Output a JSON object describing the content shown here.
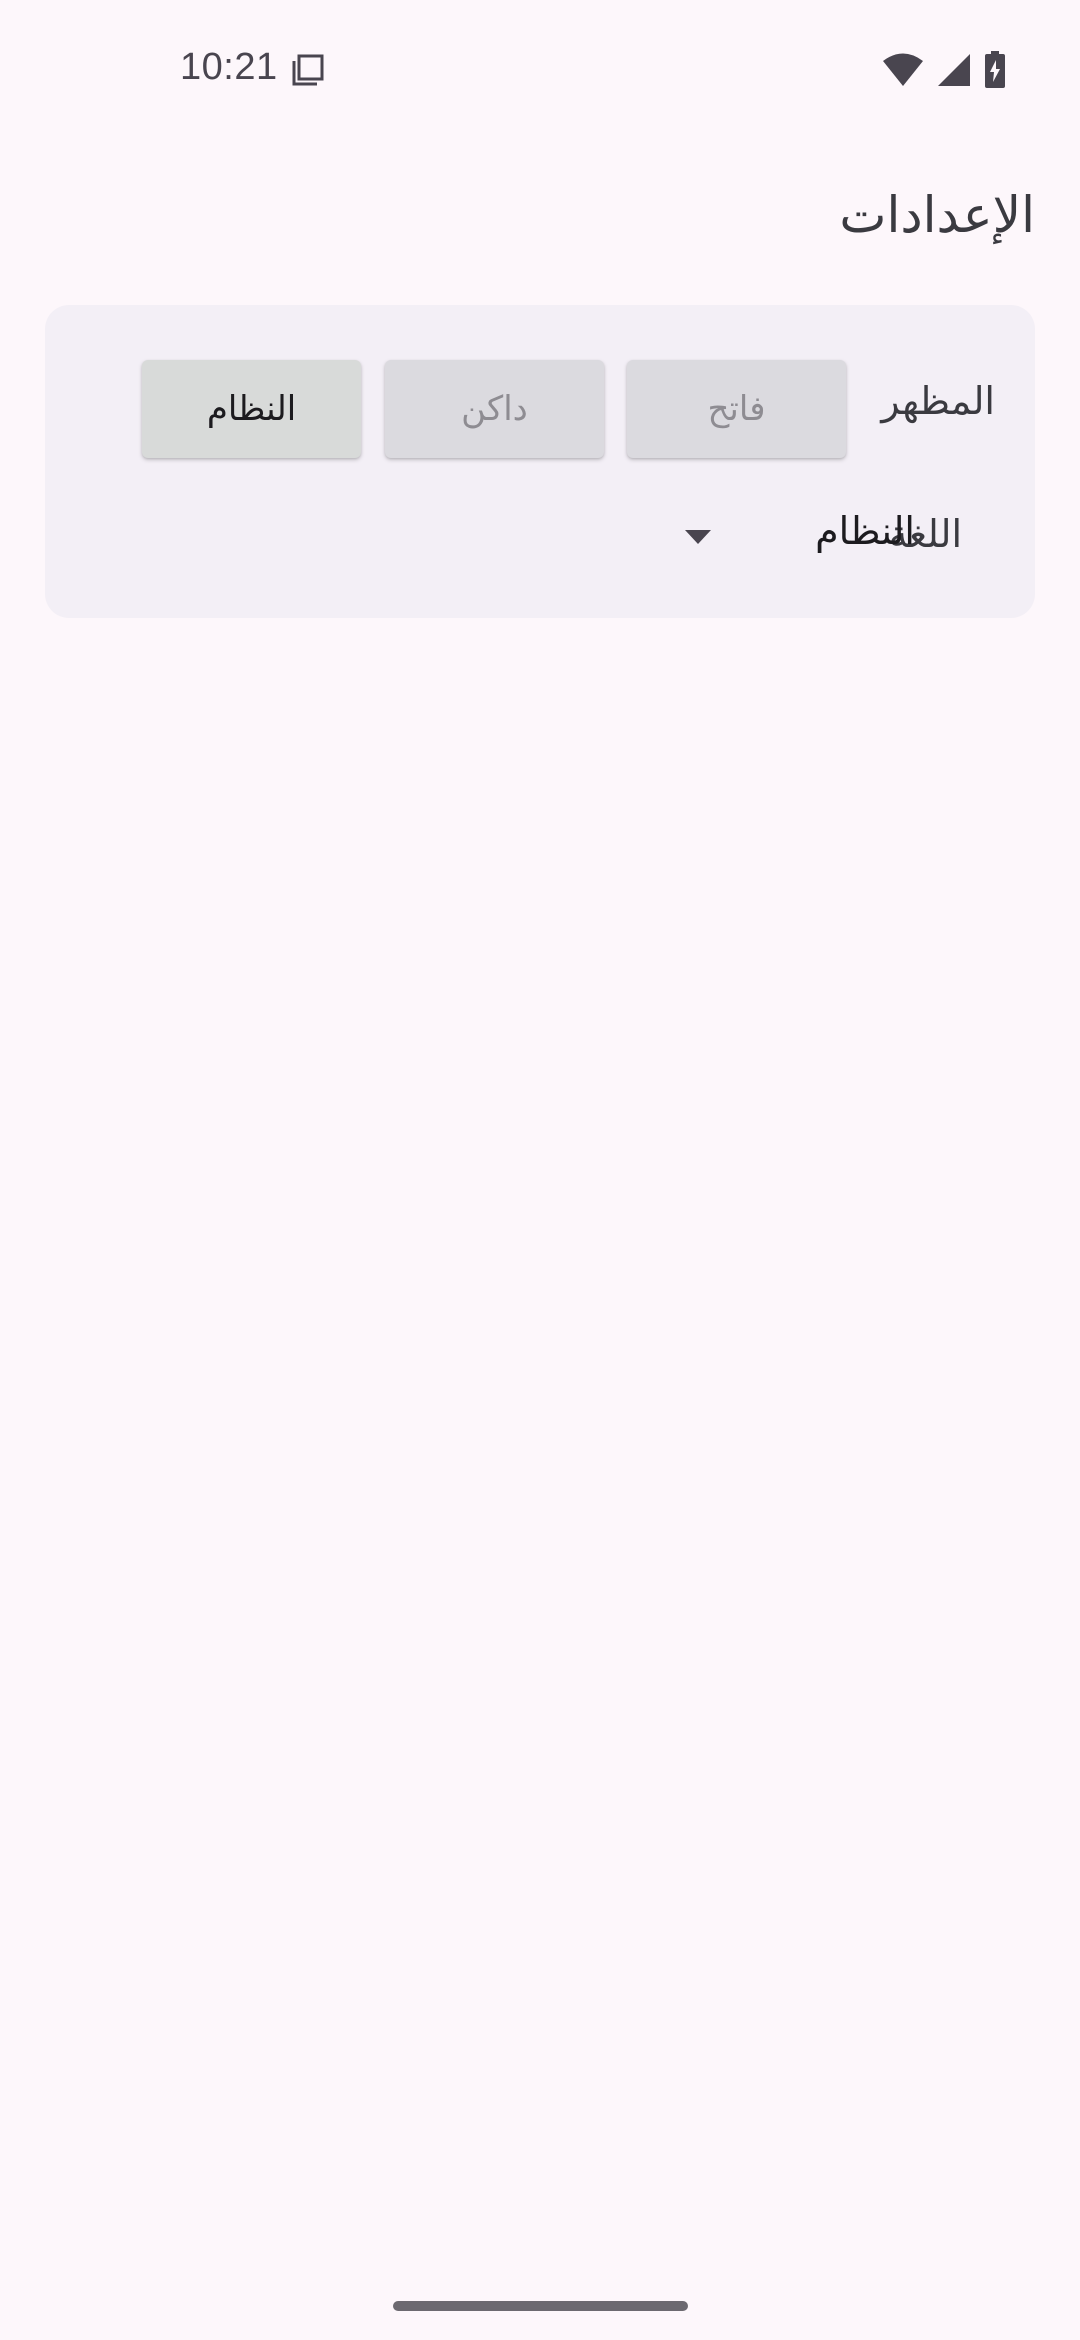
{
  "status_bar": {
    "time": "10:21",
    "left_icon": "screenshot-notification-icon",
    "right_icons": [
      "wifi-icon",
      "cellular-signal-icon",
      "battery-charging-icon"
    ]
  },
  "page": {
    "title": "الإعدادات"
  },
  "settings": {
    "appearance": {
      "label": "المظهر",
      "options": [
        {
          "label": "فاتح",
          "selected": false
        },
        {
          "label": "داكن",
          "selected": false
        },
        {
          "label": "النظام",
          "selected": true
        }
      ]
    },
    "language": {
      "label": "اللغة",
      "value": "النظام",
      "dropdown_icon": "arrow-drop-down-icon"
    }
  },
  "colors": {
    "background": "#fdf7fb",
    "card": "#f3eff6",
    "button": "#dbdadf",
    "button_selected": "#d8dad9"
  }
}
